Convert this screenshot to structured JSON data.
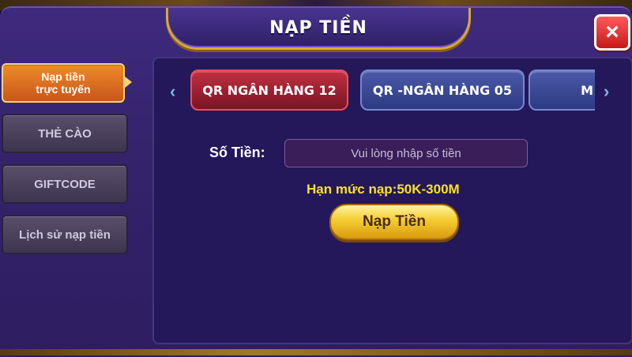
{
  "dialog": {
    "title": "NẠP TIỀN",
    "close_icon": "×"
  },
  "menu": {
    "items": [
      {
        "label": "Nạp tiền\ntrực tuyến",
        "active": true
      },
      {
        "label": "THẺ CÀO",
        "active": false
      },
      {
        "label": "GIFTCODE",
        "active": false
      },
      {
        "label": "Lịch sử nạp tiền",
        "active": false
      }
    ]
  },
  "bank_tabs": {
    "prev_arrow": "‹",
    "next_arrow": "›",
    "items": [
      {
        "label": "QR NGÂN HÀNG 12",
        "active": true
      },
      {
        "label": "QR -NGÂN HÀNG 05",
        "active": false
      },
      {
        "label": "M",
        "active": false
      }
    ]
  },
  "form": {
    "amount_label": "Số Tiền:",
    "amount_placeholder": "Vui lòng nhập số tiền",
    "amount_value": "",
    "limit_text": "Hạn mức nạp:50K-300M",
    "submit_label": "Nạp Tiền"
  },
  "colors": {
    "accent_gold": "#d9a83a",
    "active_tab": "#c03040",
    "inactive_tab": "#3a4aa0",
    "limit_yellow": "#f8e030"
  }
}
